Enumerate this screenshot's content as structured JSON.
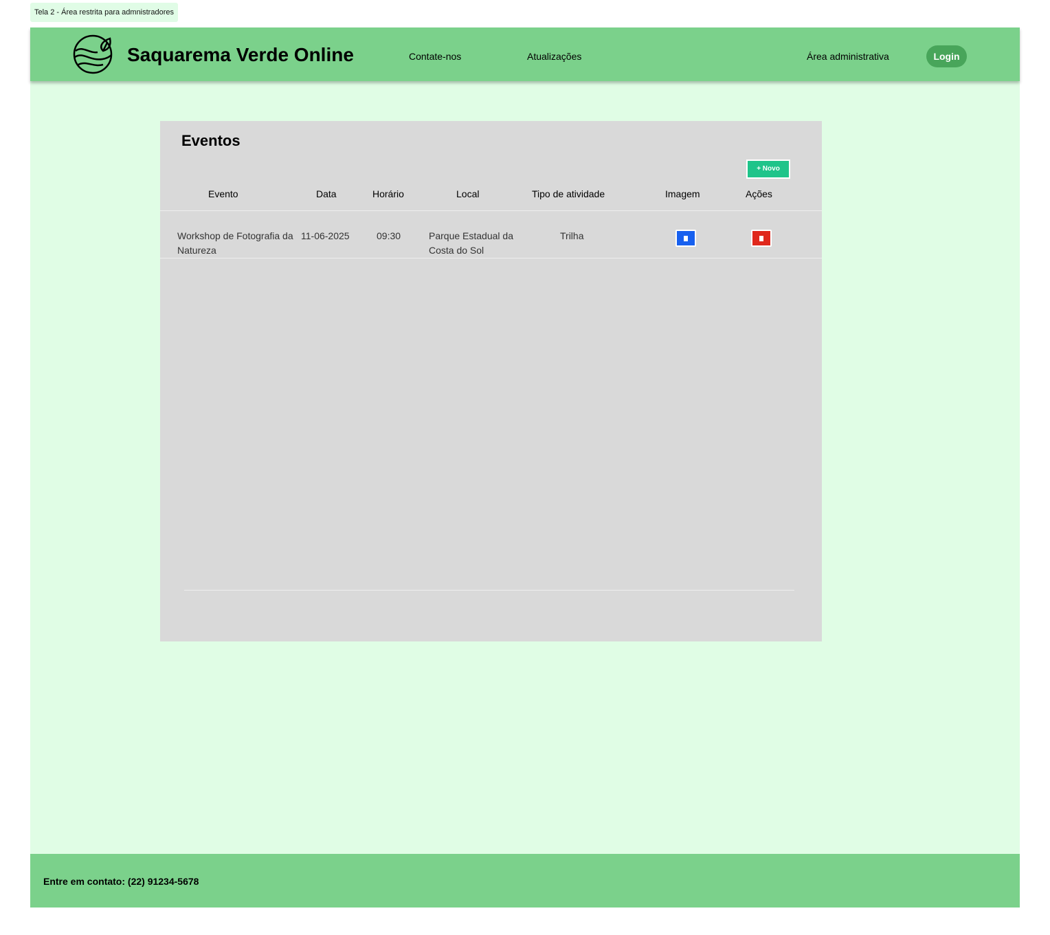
{
  "annotation": "Tela 2 - Área restrita para admnistradores",
  "header": {
    "brand": "Saquarema Verde Online",
    "nav": [
      "Contate-nos",
      "Atualizações",
      "Área administrativa"
    ],
    "login": "Login"
  },
  "panel": {
    "title": "Eventos",
    "new_button": "+ Novo",
    "columns": [
      "Evento",
      "Data",
      "Horário",
      "Local",
      "Tipo de atividade",
      "Imagem",
      "Ações"
    ],
    "rows": [
      {
        "evento": "Workshop de Fotografia da Natureza",
        "data": "11-06-2025",
        "horario": "09:30",
        "local": "Parque Estadual da Costa do Sol",
        "tipo": "Trilha",
        "image_icon": "file-icon",
        "action_icon": "trash-icon"
      }
    ]
  },
  "colors": {
    "header": "#7bd18b",
    "background": "#e0fde5",
    "new": "#1fc48a",
    "image": "#1760ef",
    "delete": "#e0281c"
  },
  "footer": {
    "contact": "Entre em contato: (22) 91234-5678"
  }
}
